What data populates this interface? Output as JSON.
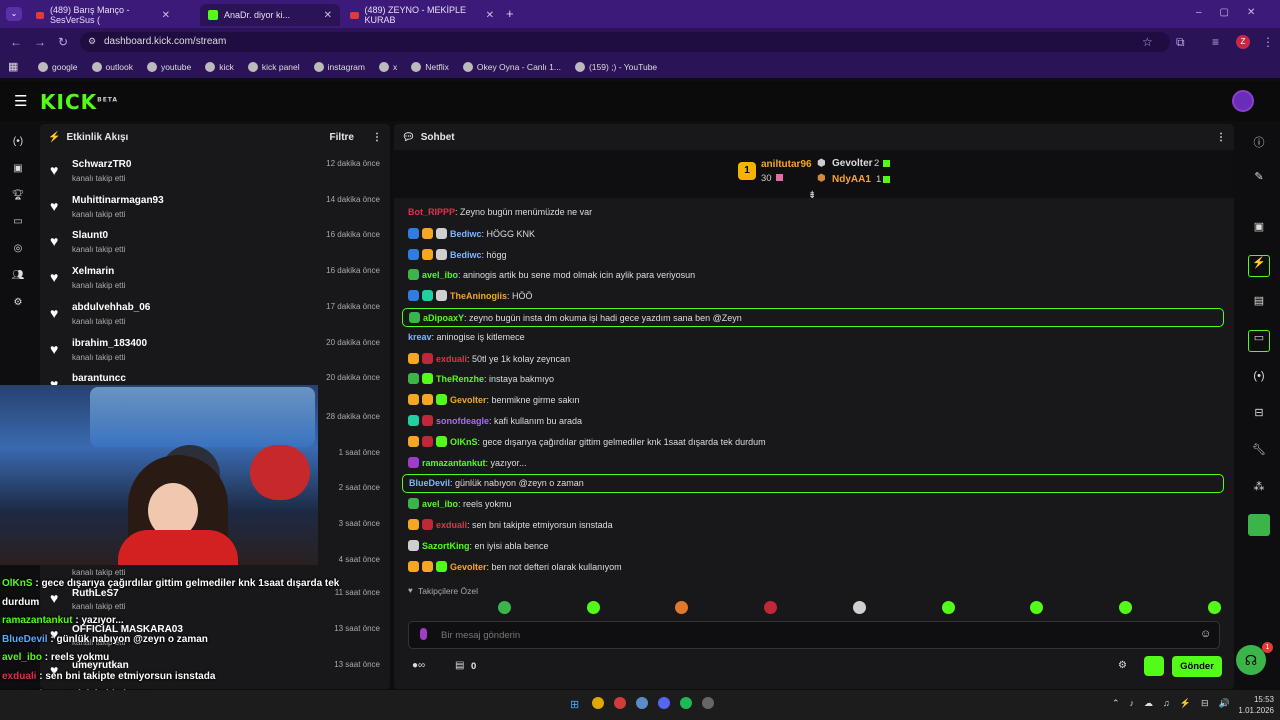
{
  "browser": {
    "tabs": [
      {
        "label": "(489) Barış Manço - SesVerSus (",
        "kind": "youtube"
      },
      {
        "label": "AnaDr. diyor ki...",
        "kind": "kick"
      },
      {
        "label": "(489) ZEYNO - MEKİPLE KURAB",
        "kind": "youtube"
      }
    ],
    "url": "dashboard.kick.com/stream",
    "profile_letter": "Z",
    "bookmarks": [
      "google",
      "outlook",
      "youtube",
      "kick",
      "kick panel",
      "instagram",
      "x",
      "Netflix",
      "Okey Oyna - Canlı 1...",
      "(159) ;) - YouTube"
    ]
  },
  "kick": {
    "logo": "KICK",
    "beta": "BETA"
  },
  "feed": {
    "title": "Etkinlik Akışı",
    "filter": "Filtre",
    "items": [
      {
        "name": "SchwarzTR0",
        "sub": "kanalı takip etti",
        "time": "12 dakika önce"
      },
      {
        "name": "Muhittinarmagan93",
        "sub": "kanalı takip etti",
        "time": "14 dakika önce"
      },
      {
        "name": "Slaunt0",
        "sub": "kanalı takip etti",
        "time": "16 dakika önce"
      },
      {
        "name": "Xelmarin",
        "sub": "kanalı takip etti",
        "time": "16 dakika önce"
      },
      {
        "name": "abdulvehhab_06",
        "sub": "kanalı takip etti",
        "time": "17 dakika önce"
      },
      {
        "name": "ibrahim_183400",
        "sub": "kanalı takip etti",
        "time": "20 dakika önce"
      },
      {
        "name": "barantuncc",
        "sub": "",
        "time": "20 dakika önce"
      }
    ],
    "hidden_times": [
      "28 dakika önce",
      "1 saat önce",
      "2 saat önce",
      "3 saat önce",
      "4 saat önce"
    ],
    "lower_items": [
      {
        "name": "",
        "sub": "kanalı takip etti",
        "time": ""
      },
      {
        "name": "RuthLeS7",
        "sub": "kanalı takip etti",
        "time": "11 saat önce"
      },
      {
        "name": "OFFICIAL MASKARA03",
        "sub": "kanalı takip etti",
        "time": "13 saat önce"
      },
      {
        "name": "umeyrutkan",
        "sub": "",
        "time": "13 saat önce"
      }
    ]
  },
  "overlay_chat": [
    {
      "user": "OlKnS",
      "text": " : gece dışarıya çağırdılar gittim gelmediler knk 1saat dışarda tek",
      "color": "#53fc18"
    },
    {
      "user": "",
      "text": "durdum",
      "color": "#ffffff"
    },
    {
      "user": "ramazantankut",
      "text": " : yazıyor...",
      "color": "#53fc18"
    },
    {
      "user": "BlueDevil",
      "text": " : günlük nabıyon @zeyn o zaman",
      "color": "#5aa9ff"
    },
    {
      "user": "avel_ibo",
      "text": " : reels yokmu",
      "color": "#53fc18"
    },
    {
      "user": "exduali",
      "text": " : sen bni takipte etmiyorsun isnstada",
      "color": "#e0324b"
    },
    {
      "user": "SazortKing",
      "text": " : en iyisi abla bence",
      "color": "#53fc18"
    },
    {
      "user": "Gevolter",
      "text": " : ben not defteri olarak kullanıyom",
      "color": "#f5a623"
    }
  ],
  "chat": {
    "title": "Sohbet",
    "leaderboard": {
      "first": {
        "rank": "1",
        "name": "aniltutar96",
        "value": "30"
      },
      "second": {
        "name": "Gevolter",
        "value": "2"
      },
      "third": {
        "name": "NdyAA1",
        "value": "1"
      }
    },
    "messages": [
      {
        "user": "Bot_RIPPP",
        "color": "#e0324b",
        "text": ": Zeyno bugün menümüzde ne var",
        "badges": [],
        "hl": false
      },
      {
        "user": "Bediwc",
        "color": "#7fb6ff",
        "text": ": HÖGG KNK",
        "badges": [
          "#2f7de0",
          "#f5a623",
          "#cfcfcf"
        ],
        "hl": false
      },
      {
        "user": "Bediwc",
        "color": "#7fb6ff",
        "text": ": högg",
        "badges": [
          "#2f7de0",
          "#f5a623",
          "#cfcfcf"
        ],
        "hl": false
      },
      {
        "user": "avel_ibo",
        "color": "#53fc18",
        "text": ": aninogis artik bu sene mod olmak icin aylik para veriyosun",
        "badges": [
          "#3bb54a"
        ],
        "hl": false
      },
      {
        "user": "TheAninogiis",
        "color": "#f5a623",
        "text": ": HÖÖ",
        "badges": [
          "#2f7de0",
          "#1fd1a0",
          "#cfcfcf"
        ],
        "hl": false
      },
      {
        "user": "aDipoaxY",
        "color": "#53fc18",
        "text": ": zeyno bugün insta dm okuma işi hadi gece yazdım sana ben @Zeyn",
        "badges": [
          "#3bb54a"
        ],
        "hl": true
      },
      {
        "user": "kreav",
        "color": "#7fb6ff",
        "text": ": aninogise iş kitlemece",
        "badges": [],
        "hl": false
      },
      {
        "user": "exduali",
        "color": "#e0324b",
        "text": ": 50tl ye 1k kolay zeyncan",
        "badges": [
          "#f5a623",
          "#c0283a"
        ],
        "hl": false
      },
      {
        "user": "TheRenzhe",
        "color": "#53fc18",
        "text": ": instaya bakmıyo",
        "badges": [
          "#3bb54a",
          "#53fc18"
        ],
        "hl": false
      },
      {
        "user": "Gevolter",
        "color": "#f5a623",
        "text": ": benmikne girme sakın",
        "badges": [
          "#f5a623",
          "#f5a623",
          "#53fc18"
        ],
        "hl": false
      },
      {
        "user": "sonofdeagle",
        "color": "#a56bff",
        "text": ": kafi kullanım bu arada",
        "badges": [
          "#1fd1a0",
          "#c0283a"
        ],
        "hl": false
      },
      {
        "user": "OlKnS",
        "color": "#53fc18",
        "text": ": gece dışarıya çağırdılar gittim gelmediler knk 1saat dışarda tek durdum",
        "badges": [
          "#f5a623",
          "#c0283a",
          "#53fc18"
        ],
        "hl": false
      },
      {
        "user": "ramazantankut",
        "color": "#53fc18",
        "text": ": yazıyor...",
        "badges": [
          "#a03cc8"
        ],
        "hl": false
      },
      {
        "user": "BlueDevil",
        "color": "#7fb6ff",
        "text": ": günlük nabıyon @zeyn o zaman",
        "badges": [],
        "hl": true
      },
      {
        "user": "avel_ibo",
        "color": "#53fc18",
        "text": ": reels yokmu",
        "badges": [
          "#3bb54a"
        ],
        "hl": false
      },
      {
        "user": "exduali",
        "color": "#e0324b",
        "text": ": sen bni takipte etmiyorsun isnstada",
        "badges": [
          "#f5a623",
          "#c0283a"
        ],
        "hl": false
      },
      {
        "user": "SazortKing",
        "color": "#53fc18",
        "text": ": en iyisi abla bence",
        "badges": [
          "#cfcfcf"
        ],
        "hl": false
      },
      {
        "user": "Gevolter",
        "color": "#f5a623",
        "text": ": ben not defteri olarak kullanıyom",
        "badges": [
          "#f5a623",
          "#f5a623",
          "#53fc18"
        ],
        "hl": false
      }
    ],
    "followers_only": "Takipçilere Özel",
    "input_placeholder": "Bir mesaj gönderin",
    "points": "0",
    "send": "Gönder",
    "notif_count": "1"
  },
  "taskbar": {
    "time": "15:53",
    "date": "1.01.2026"
  }
}
